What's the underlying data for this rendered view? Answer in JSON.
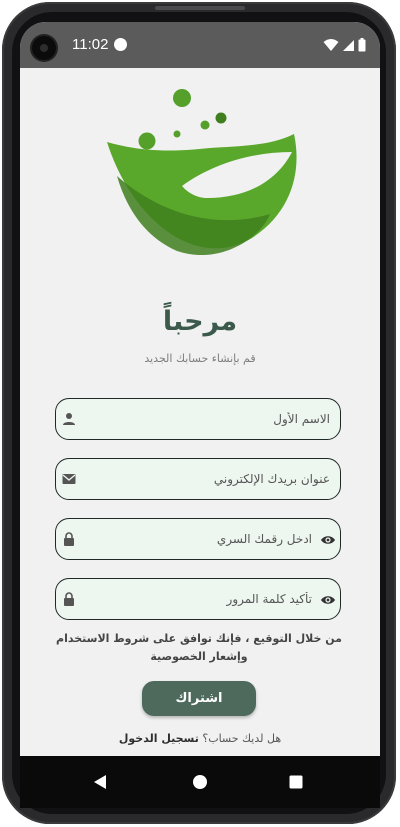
{
  "status_bar": {
    "time": "11:02"
  },
  "header": {
    "title": "مرحباً",
    "subtitle": "قم بإنشاء حسابك الجديد"
  },
  "form": {
    "first_name": {
      "placeholder": "الاسم الأول",
      "value": ""
    },
    "email": {
      "placeholder": "عنوان بريدك الإلكتروني",
      "value": ""
    },
    "password": {
      "placeholder": "ادخل رقمك السري",
      "value": ""
    },
    "confirm_password": {
      "placeholder": "تأكيد كلمة المرور",
      "value": ""
    }
  },
  "terms_text": "من خلال التوقيع ، فإنك توافق على شروط الاستخدام وإشعار الخصوصية",
  "signup_label": "اشتراك",
  "login_prompt": {
    "question": "هل لديك حساب؟",
    "link": "تسجيل الدخول"
  },
  "colors": {
    "accent": "#4d6a5d",
    "title": "#3b5a4c",
    "field_bg": "#eef6f0",
    "leaf_green": "#4e9a23"
  },
  "icons": {
    "first_name": "person-icon",
    "email": "mail-icon",
    "password": "lock-icon",
    "password_toggle": "eye-icon",
    "nav_back": "back-triangle-icon",
    "nav_home": "home-circle-icon",
    "nav_recents": "recents-square-icon"
  }
}
